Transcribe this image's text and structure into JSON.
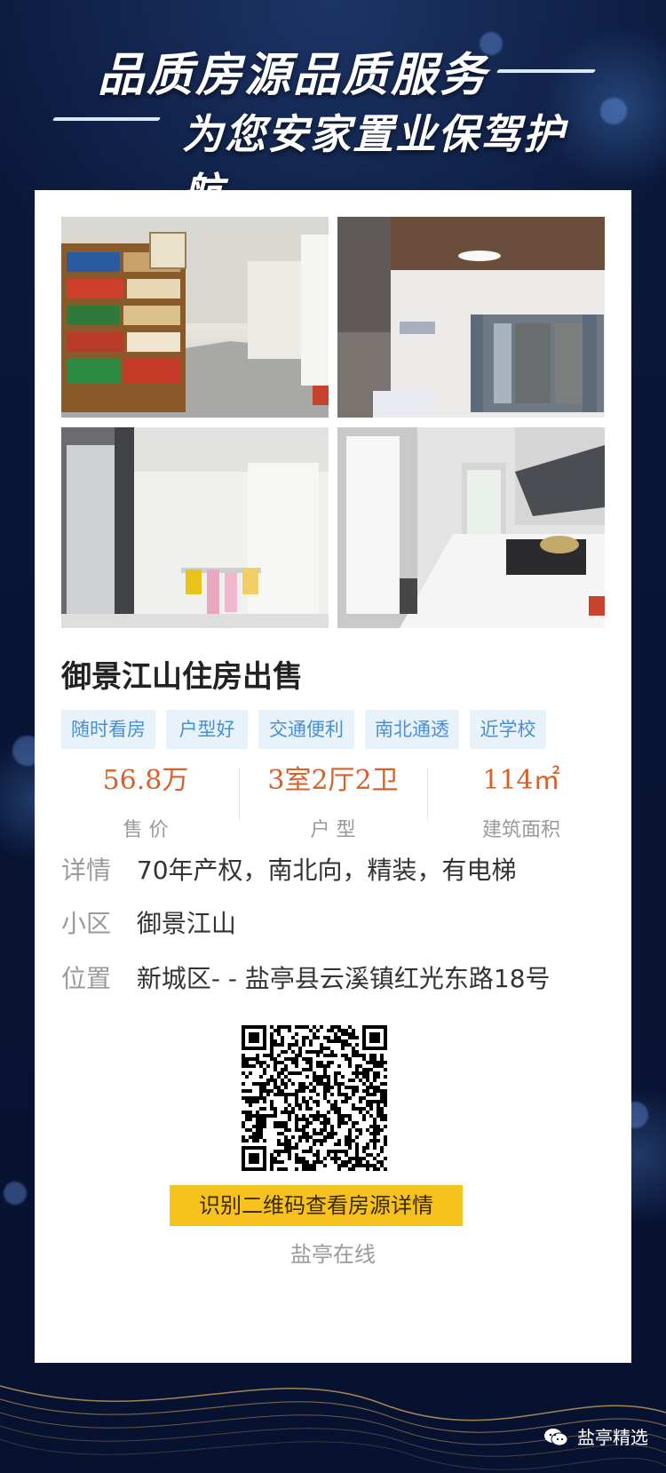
{
  "header": {
    "line1": "品质房源品质服务",
    "line2": "为您安家置业保驾护航"
  },
  "listing": {
    "title": "御景江山住房出售",
    "tags": [
      "随时看房",
      "户型好",
      "交通便利",
      "南北通透",
      "近学校"
    ],
    "stats": [
      {
        "value": "56.8万",
        "label": "售 价"
      },
      {
        "value": "3室2厅2卫",
        "label": "户 型"
      },
      {
        "value": "114㎡",
        "label": "建筑面积"
      }
    ],
    "details": {
      "label": "详情",
      "value": "70年产权，南北向，精装，有电梯"
    },
    "community": {
      "label": "小区",
      "value": "御景江山"
    },
    "location": {
      "label": "位置",
      "value": "新城区- - 盐亭县云溪镇红光东路18号"
    }
  },
  "qr": {
    "button_label": "识别二维码查看房源详情",
    "source": "盐亭在线"
  },
  "watermark": {
    "text": "盐亭精选"
  },
  "colors": {
    "accent_orange": "#d8612b",
    "tag_bg": "#e8f2fb",
    "tag_text": "#4a8fcf",
    "button_yellow": "#f7c21e",
    "background_navy": "#08132e"
  }
}
